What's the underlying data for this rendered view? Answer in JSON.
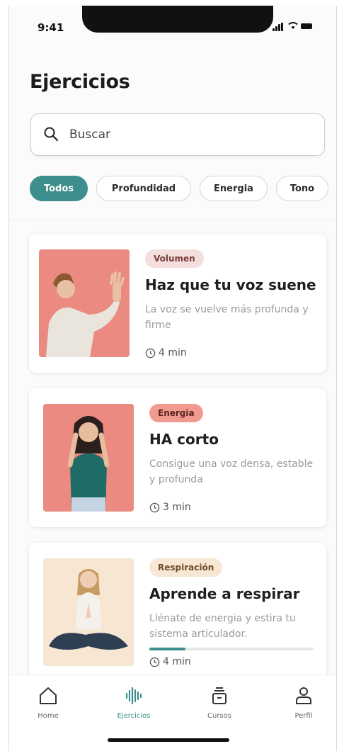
{
  "status_bar": {
    "time": "9:41"
  },
  "header": {
    "title": "Ejercicios"
  },
  "search": {
    "placeholder": "Buscar"
  },
  "filters": [
    {
      "label": "Todos",
      "active": true
    },
    {
      "label": "Profundidad",
      "active": false
    },
    {
      "label": "Energia",
      "active": false
    },
    {
      "label": "Tono",
      "active": false
    }
  ],
  "exercises": [
    {
      "badge": "Volumen",
      "title": "Haz que tu voz suene",
      "description": "La voz se vuelve más profunda y firme",
      "duration": "4 min"
    },
    {
      "badge": "Energia",
      "title": "HA corto",
      "description": "Consigue una voz densa, estable y profunda",
      "duration": "3 min"
    },
    {
      "badge": "Respiración",
      "title": "Aprende a respirar",
      "description": "Llénate de energia y estira tu sistema articulador.",
      "duration": "4 min",
      "progress": 0.22
    }
  ],
  "tabbar": {
    "items": [
      {
        "label": "Home",
        "icon": "home-icon"
      },
      {
        "label": "Ejercicios",
        "icon": "soundwave-icon",
        "active": true
      },
      {
        "label": "Cursos",
        "icon": "courses-icon"
      },
      {
        "label": "Perfil",
        "icon": "profile-icon"
      }
    ]
  },
  "colors": {
    "accent": "#3c8f8c",
    "salmon": "#ea8a80",
    "cream": "#f6e6d2"
  }
}
